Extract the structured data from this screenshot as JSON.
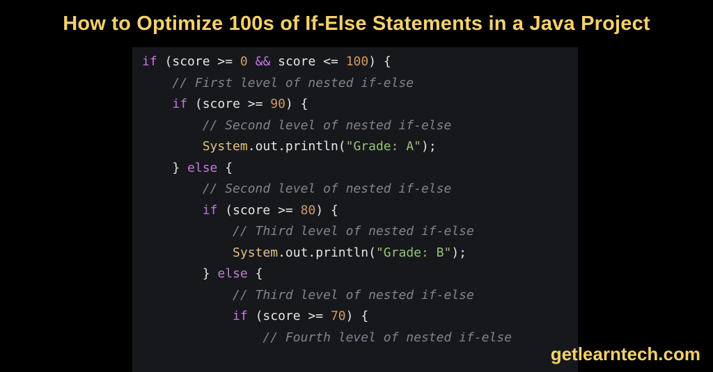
{
  "title": "How to Optimize 100s of If-Else Statements in a Java Project",
  "brand": "getlearntech.com",
  "code": {
    "lines": [
      {
        "indent": 0,
        "tokens": [
          {
            "c": "kw",
            "t": "if"
          },
          {
            "c": "pn",
            "t": " (score "
          },
          {
            "c": "pn",
            "t": ">="
          },
          {
            "c": "pn",
            "t": " "
          },
          {
            "c": "num",
            "t": "0"
          },
          {
            "c": "pn",
            "t": " "
          },
          {
            "c": "op",
            "t": "&&"
          },
          {
            "c": "pn",
            "t": " score "
          },
          {
            "c": "pn",
            "t": "<="
          },
          {
            "c": "pn",
            "t": " "
          },
          {
            "c": "num",
            "t": "100"
          },
          {
            "c": "pn",
            "t": ") {"
          }
        ]
      },
      {
        "indent": 1,
        "tokens": [
          {
            "c": "cmt",
            "t": "// First level of nested if-else"
          }
        ]
      },
      {
        "indent": 1,
        "tokens": [
          {
            "c": "kw",
            "t": "if"
          },
          {
            "c": "pn",
            "t": " (score "
          },
          {
            "c": "pn",
            "t": ">="
          },
          {
            "c": "pn",
            "t": " "
          },
          {
            "c": "num",
            "t": "90"
          },
          {
            "c": "pn",
            "t": ") {"
          }
        ]
      },
      {
        "indent": 2,
        "tokens": [
          {
            "c": "cmt",
            "t": "// Second level of nested if-else"
          }
        ]
      },
      {
        "indent": 2,
        "tokens": [
          {
            "c": "sys",
            "t": "System"
          },
          {
            "c": "pn",
            "t": ".out."
          },
          {
            "c": "fn",
            "t": "println"
          },
          {
            "c": "pn",
            "t": "("
          },
          {
            "c": "str",
            "t": "\"Grade: A\""
          },
          {
            "c": "pn",
            "t": ");"
          }
        ]
      },
      {
        "indent": 1,
        "tokens": [
          {
            "c": "pn",
            "t": "} "
          },
          {
            "c": "kw",
            "t": "else"
          },
          {
            "c": "pn",
            "t": " {"
          }
        ]
      },
      {
        "indent": 2,
        "tokens": [
          {
            "c": "cmt",
            "t": "// Second level of nested if-else"
          }
        ]
      },
      {
        "indent": 2,
        "tokens": [
          {
            "c": "kw",
            "t": "if"
          },
          {
            "c": "pn",
            "t": " (score "
          },
          {
            "c": "pn",
            "t": ">="
          },
          {
            "c": "pn",
            "t": " "
          },
          {
            "c": "num",
            "t": "80"
          },
          {
            "c": "pn",
            "t": ") {"
          }
        ]
      },
      {
        "indent": 3,
        "tokens": [
          {
            "c": "cmt",
            "t": "// Third level of nested if-else"
          }
        ]
      },
      {
        "indent": 3,
        "tokens": [
          {
            "c": "sys",
            "t": "System"
          },
          {
            "c": "pn",
            "t": ".out."
          },
          {
            "c": "fn",
            "t": "println"
          },
          {
            "c": "pn",
            "t": "("
          },
          {
            "c": "str",
            "t": "\"Grade: B\""
          },
          {
            "c": "pn",
            "t": ");"
          }
        ]
      },
      {
        "indent": 2,
        "tokens": [
          {
            "c": "pn",
            "t": "} "
          },
          {
            "c": "kw",
            "t": "else"
          },
          {
            "c": "pn",
            "t": " {"
          }
        ]
      },
      {
        "indent": 3,
        "tokens": [
          {
            "c": "cmt",
            "t": "// Third level of nested if-else"
          }
        ]
      },
      {
        "indent": 3,
        "tokens": [
          {
            "c": "kw",
            "t": "if"
          },
          {
            "c": "pn",
            "t": " (score "
          },
          {
            "c": "pn",
            "t": ">="
          },
          {
            "c": "pn",
            "t": " "
          },
          {
            "c": "num",
            "t": "70"
          },
          {
            "c": "pn",
            "t": ") {"
          }
        ]
      },
      {
        "indent": 4,
        "tokens": [
          {
            "c": "cmt",
            "t": "// Fourth level of nested if-else"
          }
        ]
      }
    ],
    "indentUnit": "    "
  }
}
